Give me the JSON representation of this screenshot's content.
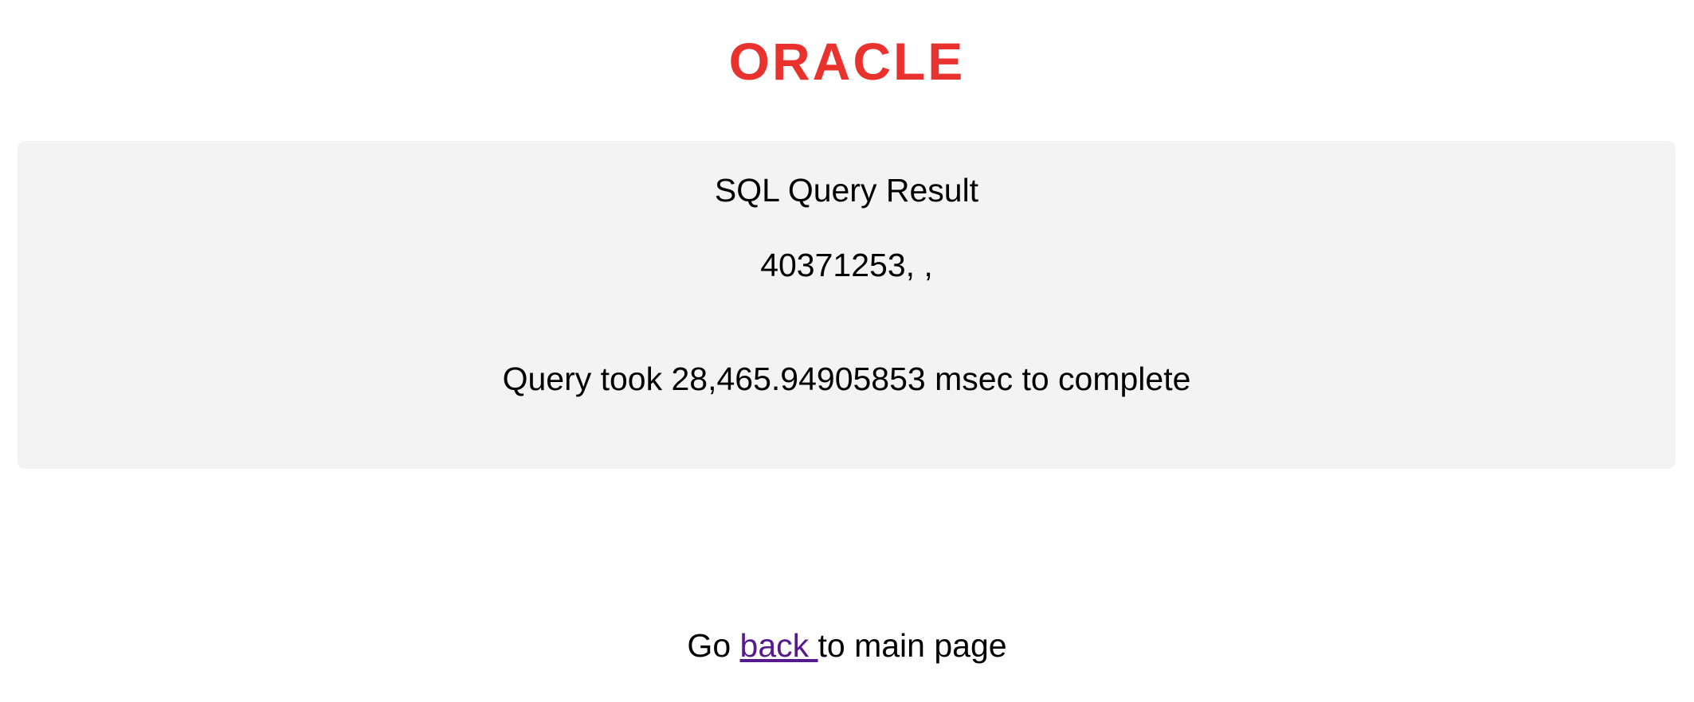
{
  "header": {
    "logo_text": "ORACLE",
    "logo_color": "#e9322e"
  },
  "result": {
    "title": "SQL Query Result",
    "value": "40371253, ,",
    "timing": "Query took 28,465.94905853 msec to complete"
  },
  "footer": {
    "prefix": "Go ",
    "link_label": "back ",
    "suffix": "to main page",
    "link_color": "#551a8b"
  },
  "colors": {
    "panel_background": "#f3f3f3",
    "page_background": "#ffffff"
  }
}
